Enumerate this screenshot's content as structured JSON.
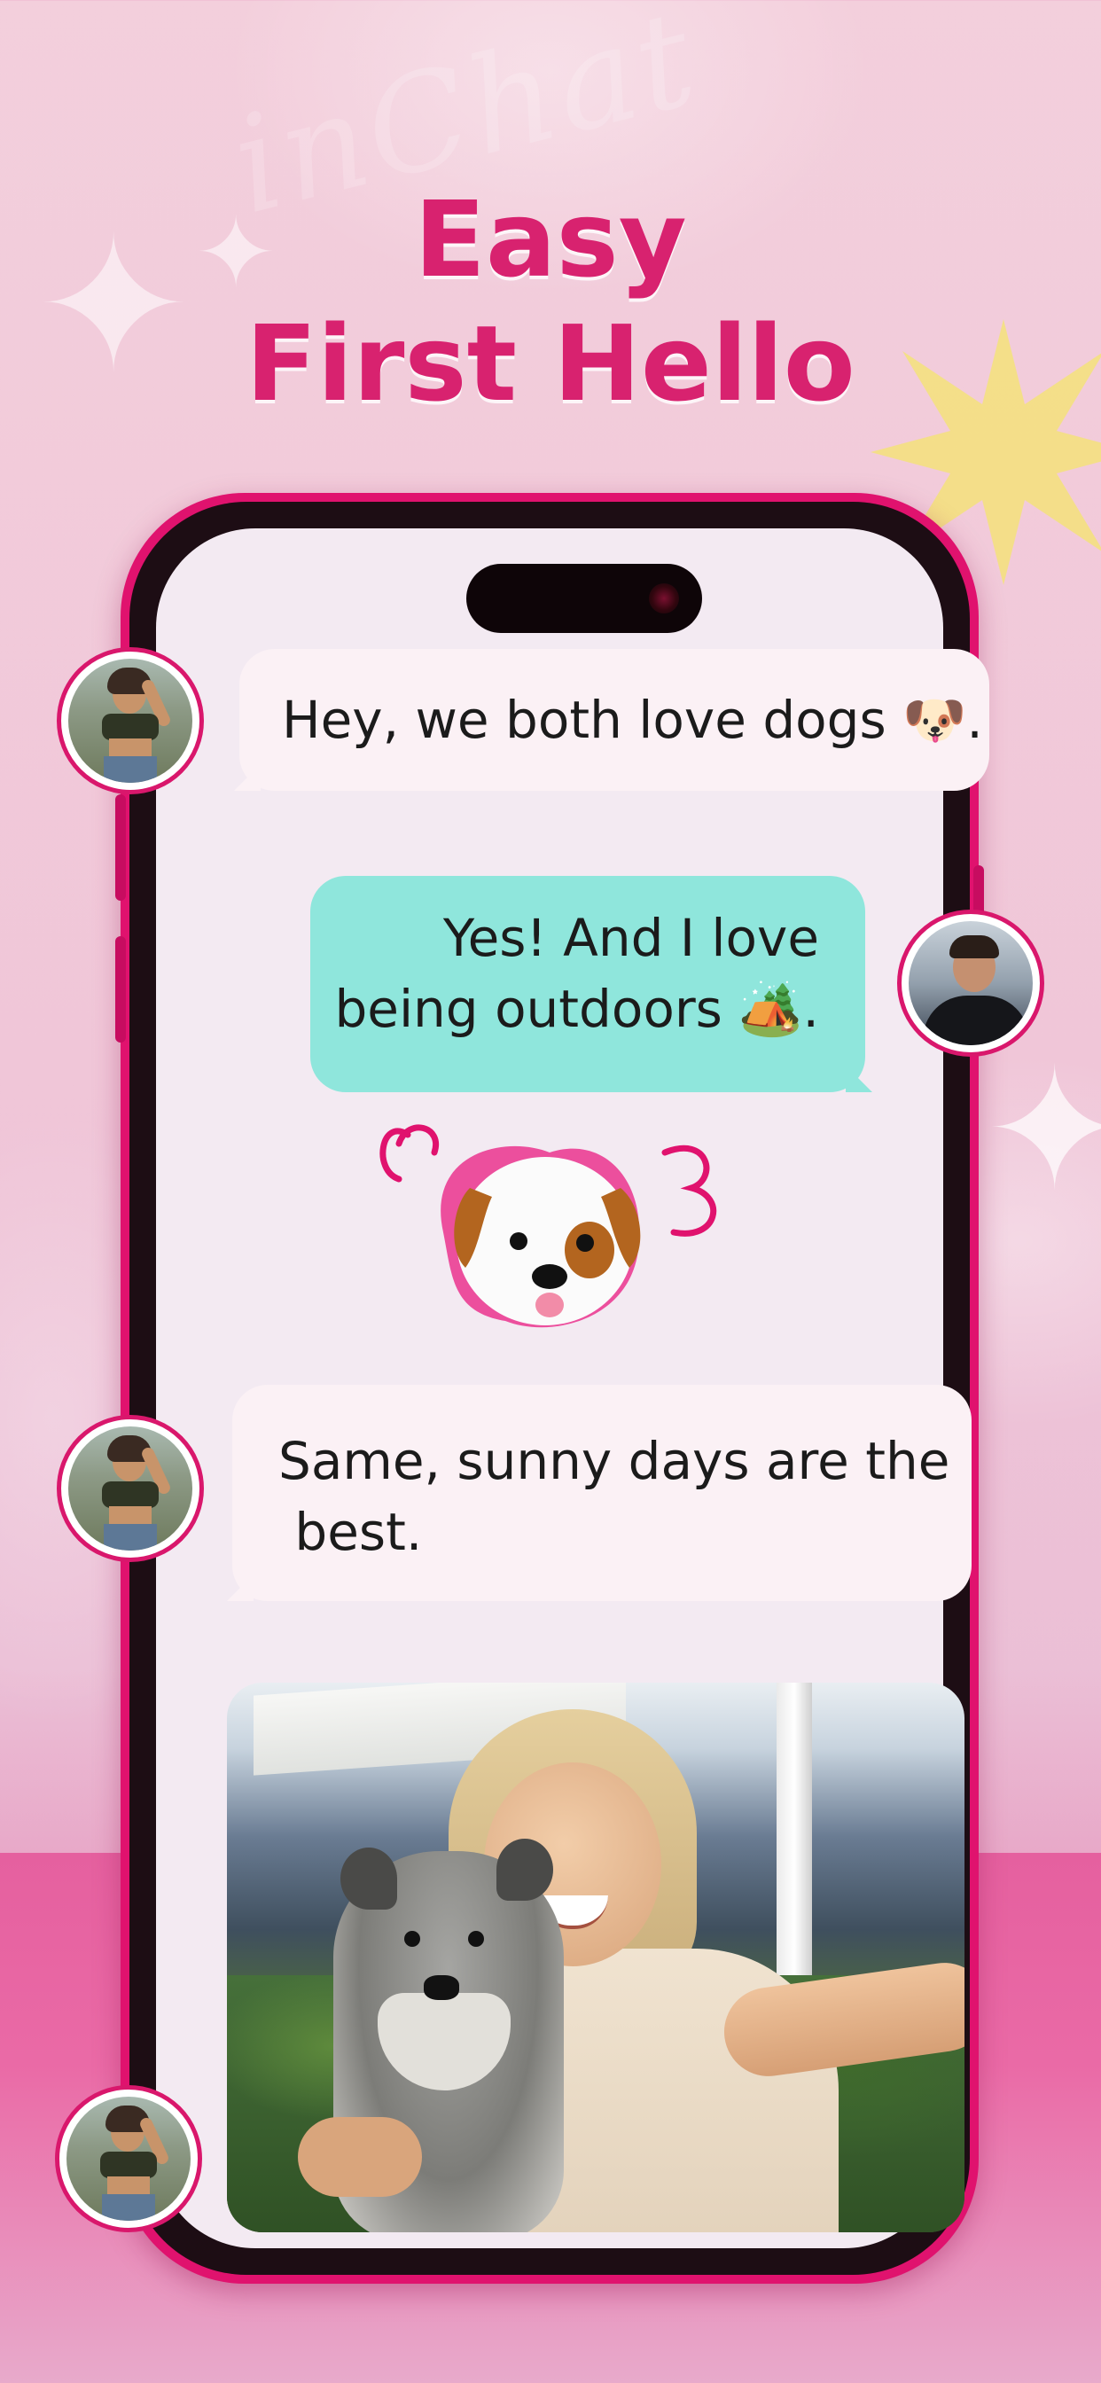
{
  "headline": {
    "line1": "Easy",
    "line2": "First Hello"
  },
  "colors": {
    "accent": "#d8226f",
    "phone_frame": "#e0126e",
    "incoming_bubble": "#fbf1f5",
    "outgoing_bubble": "#8fe6dc",
    "screen_bg": "#f3eaf2"
  },
  "messages": [
    {
      "sender": "her",
      "type": "text",
      "text": "Hey, we both love dogs 🐶."
    },
    {
      "sender": "him",
      "type": "text",
      "line1": "Yes! And I love",
      "line2": "being outdoors 🏕️."
    },
    {
      "sender": "him",
      "type": "sticker",
      "icon": "puppy-face-sticker"
    },
    {
      "sender": "her",
      "type": "text",
      "line1": "Same, sunny days are the",
      "line2": " best."
    },
    {
      "sender": "her",
      "type": "photo",
      "icon": "selfie-with-dog-photo"
    }
  ]
}
